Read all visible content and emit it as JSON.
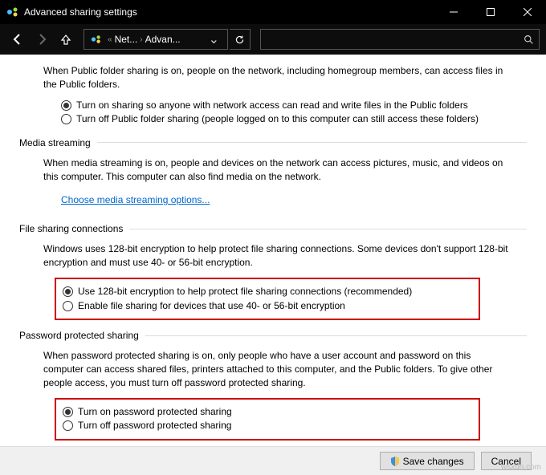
{
  "title": "Advanced sharing settings",
  "breadcrumb": {
    "seg1": "Net...",
    "seg2": "Advan..."
  },
  "publicFolder": {
    "desc": "When Public folder sharing is on, people on the network, including homegroup members, can access files in the Public folders.",
    "opt1": "Turn on sharing so anyone with network access can read and write files in the Public folders",
    "opt2": "Turn off Public folder sharing (people logged on to this computer can still access these folders)"
  },
  "mediaStreaming": {
    "header": "Media streaming",
    "desc": "When media streaming is on, people and devices on the network can access pictures, music, and videos on this computer. This computer can also find media on the network.",
    "link": "Choose media streaming options..."
  },
  "fileSharing": {
    "header": "File sharing connections",
    "desc": "Windows uses 128-bit encryption to help protect file sharing connections. Some devices don't support 128-bit encryption and must use 40- or 56-bit encryption.",
    "opt1": "Use 128-bit encryption to help protect file sharing connections (recommended)",
    "opt2": "Enable file sharing for devices that use 40- or 56-bit encryption"
  },
  "passwordSharing": {
    "header": "Password protected sharing",
    "desc": "When password protected sharing is on, only people who have a user account and password on this computer can access shared files, printers attached to this computer, and the Public folders. To give other people access, you must turn off password protected sharing.",
    "opt1": "Turn on password protected sharing",
    "opt2": "Turn off password protected sharing"
  },
  "footer": {
    "save": "Save changes",
    "cancel": "Cancel"
  },
  "watermark": "wsxdn.com"
}
